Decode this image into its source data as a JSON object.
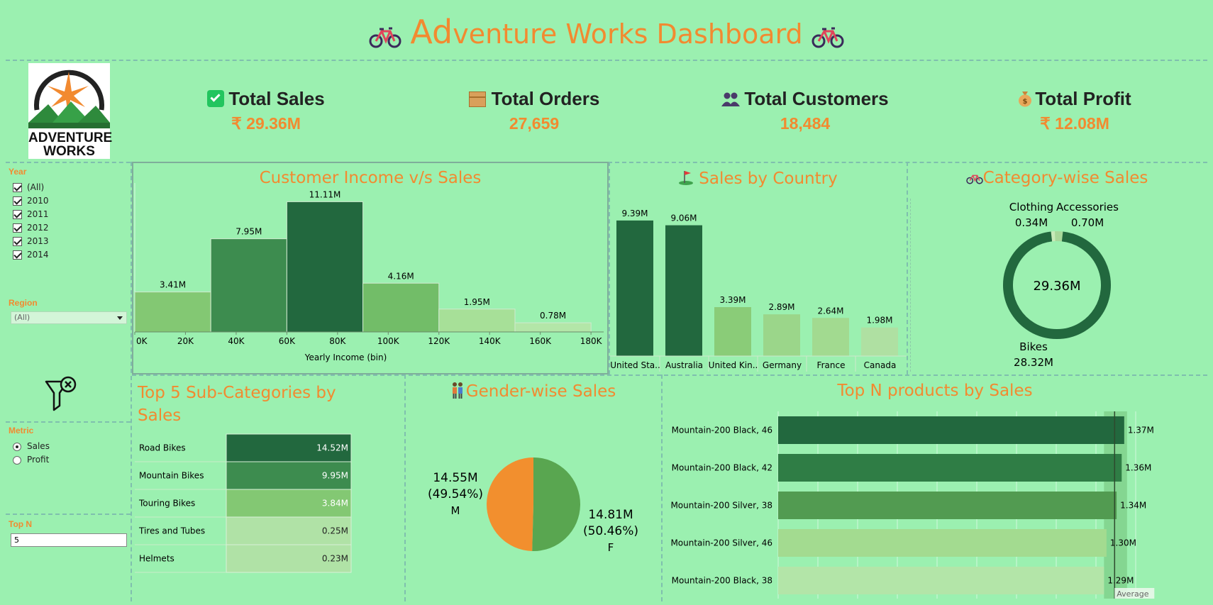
{
  "header": {
    "title_first": "Ad",
    "title_rest": "venture Works Dashboard"
  },
  "logo": {
    "line1": "ADVENTURE",
    "line2": "WORKS"
  },
  "kpis": [
    {
      "label": "Total Sales",
      "value": "₹ 29.36M",
      "icon": "check-icon"
    },
    {
      "label": "Total Orders",
      "value": "27,659",
      "icon": "package-icon"
    },
    {
      "label": "Total Customers",
      "value": "18,484",
      "icon": "people-icon"
    },
    {
      "label": "Total Profit",
      "value": "₹ 12.08M",
      "icon": "money-bag-icon"
    }
  ],
  "filters": {
    "year_label": "Year",
    "years": [
      "(All)",
      "2010",
      "2011",
      "2012",
      "2013",
      "2014"
    ],
    "region_label": "Region",
    "region_value": "(All)",
    "metric_label": "Metric",
    "metric_options": [
      "Sales",
      "Profit"
    ],
    "metric_selected": "Sales",
    "topn_label": "Top N",
    "topn_value": "5"
  },
  "panels": {
    "income_title": "Customer Income v/s Sales",
    "country_title": "Sales by Country",
    "category_title": "Category-wise Sales",
    "subcat_title_1": "Top 5 Sub-Categories by",
    "subcat_title_2": "Sales",
    "gender_title": "Gender-wise Sales",
    "products_title": "Top N products by Sales"
  },
  "colors": {
    "accent": "#f28a30",
    "bg": "#9bf0b0",
    "dark_green": "#22683e",
    "mid_green": "#3d8c4f",
    "light_green": "#83c873",
    "pale_green": "#b0e2a6"
  },
  "chart_data": [
    {
      "id": "income",
      "type": "bar",
      "title": "Customer Income v/s Sales",
      "xlabel": "Yearly Income (bin)",
      "bins": [
        0,
        30000,
        60000,
        90000,
        120000,
        150000
      ],
      "bin_width": 30000,
      "values": [
        3.41,
        7.95,
        11.11,
        4.16,
        1.95,
        0.78
      ],
      "value_labels": [
        "3.41M",
        "7.95M",
        "11.11M",
        "4.16M",
        "1.95M",
        "0.78M"
      ],
      "x_ticks": [
        "0K",
        "20K",
        "40K",
        "60K",
        "80K",
        "100K",
        "120K",
        "140K",
        "160K",
        "180K"
      ],
      "x_tick_values": [
        0,
        20000,
        40000,
        60000,
        80000,
        100000,
        120000,
        140000,
        160000,
        180000
      ],
      "xlim": [
        0,
        185000
      ],
      "colors": [
        "#83c873",
        "#3d8c4f",
        "#22683e",
        "#72bd68",
        "#a7e098",
        "#b3e6a8"
      ]
    },
    {
      "id": "country",
      "type": "bar",
      "title": "Sales by Country",
      "categories": [
        "United Sta..",
        "Australia",
        "United Kin..",
        "Germany",
        "France",
        "Canada"
      ],
      "values": [
        9.39,
        9.06,
        3.39,
        2.89,
        2.64,
        1.98
      ],
      "value_labels": [
        "9.39M",
        "9.06M",
        "3.39M",
        "2.89M",
        "2.64M",
        "1.98M"
      ],
      "colors": [
        "#22683e",
        "#22683e",
        "#8acc78",
        "#9bd68a",
        "#a2da90",
        "#afe0a2"
      ]
    },
    {
      "id": "category",
      "type": "pie",
      "title": "Category-wise Sales",
      "center_label": "29.36M",
      "categories": [
        "Bikes",
        "Accessories",
        "Clothing"
      ],
      "values": [
        28.32,
        0.7,
        0.34
      ],
      "value_labels": [
        "28.32M",
        "0.70M",
        "0.34M"
      ],
      "colors": [
        "#22683e",
        "#a8d89a",
        "#c7eab8"
      ]
    },
    {
      "id": "subcategory",
      "type": "table",
      "title": "Top 5 Sub-Categories by Sales",
      "categories": [
        "Road Bikes",
        "Mountain Bikes",
        "Touring Bikes",
        "Tires and Tubes",
        "Helmets"
      ],
      "values": [
        14.52,
        9.95,
        3.84,
        0.25,
        0.23
      ],
      "value_labels": [
        "14.52M",
        "9.95M",
        "3.84M",
        "0.25M",
        "0.23M"
      ],
      "colors": [
        "#22683e",
        "#3d8c4f",
        "#83c873",
        "#b0e2a6",
        "#b0e2a6"
      ]
    },
    {
      "id": "gender",
      "type": "pie",
      "title": "Gender-wise Sales",
      "categories": [
        "M",
        "F"
      ],
      "values": [
        14.55,
        14.81
      ],
      "value_labels": [
        "14.55M",
        "14.81M"
      ],
      "percent_labels": [
        "(49.54%)",
        "(50.46%)"
      ],
      "colors": [
        "#f28f2e",
        "#59a650"
      ]
    },
    {
      "id": "products",
      "type": "bar",
      "orientation": "horizontal",
      "title": "Top N products by Sales",
      "categories": [
        "Mountain-200 Black, 46",
        "Mountain-200 Black, 42",
        "Mountain-200 Silver, 38",
        "Mountain-200 Silver, 46",
        "Mountain-200 Black, 38"
      ],
      "values": [
        1.37,
        1.36,
        1.34,
        1.3,
        1.29
      ],
      "value_labels": [
        "1.37M",
        "1.36M",
        "1.34M",
        "1.30M",
        "1.29M"
      ],
      "average_label": "Average",
      "average": 1.332,
      "xlim": [
        0,
        1.48
      ],
      "colors": [
        "#22683e",
        "#2f7d45",
        "#529b51",
        "#a3db90",
        "#b3e5a8"
      ]
    }
  ]
}
